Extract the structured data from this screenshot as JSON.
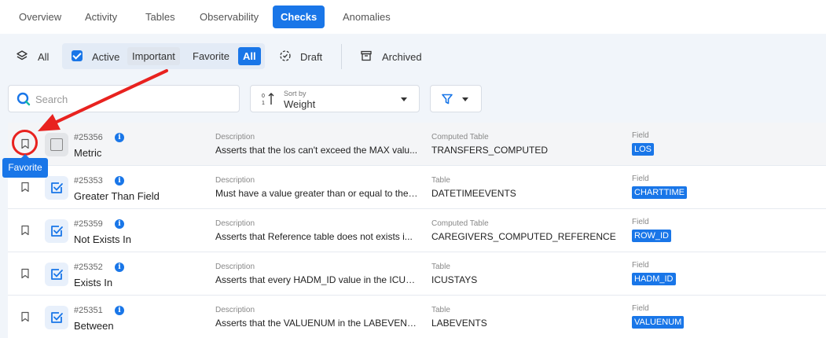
{
  "tabs": [
    {
      "label": "Overview",
      "active": false
    },
    {
      "label": "Activity",
      "active": false
    },
    {
      "label": "Tables",
      "active": false
    },
    {
      "label": "Observability",
      "active": false
    },
    {
      "label": "Checks",
      "active": true
    },
    {
      "label": "Anomalies",
      "active": false
    }
  ],
  "filters": {
    "all_label": "All",
    "active_label": "Active",
    "important_label": "Important",
    "favorite_label": "Favorite",
    "all_sub_label": "All",
    "draft_label": "Draft",
    "archived_label": "Archived"
  },
  "search": {
    "placeholder": "Search",
    "value": ""
  },
  "sort": {
    "label": "Sort by",
    "value": "Weight"
  },
  "tooltip": {
    "text": "Favorite"
  },
  "colors": {
    "accent": "#1976e8",
    "annotation": "#e8221f"
  },
  "rows": [
    {
      "id": "#25356",
      "name": "Metric",
      "desc_label": "Description",
      "desc": "Asserts that the los can't exceed the MAX valu...",
      "table_label": "Computed Table",
      "table": "TRANSFERS_COMPUTED",
      "field_label": "Field",
      "field": "LOS"
    },
    {
      "id": "#25353",
      "name": "Greater Than Field",
      "desc_label": "Description",
      "desc": "Must have a value greater than or equal to the ...",
      "table_label": "Table",
      "table": "DATETIMEEVENTS",
      "field_label": "Field",
      "field": "CHARTTIME"
    },
    {
      "id": "#25359",
      "name": "Not Exists In",
      "desc_label": "Description",
      "desc": "Asserts that Reference table does not exists i...",
      "table_label": "Computed Table",
      "table": "CAREGIVERS_COMPUTED_REFERENCE",
      "field_label": "Field",
      "field": "ROW_ID"
    },
    {
      "id": "#25352",
      "name": "Exists In",
      "desc_label": "Description",
      "desc": "Asserts that every HADM_ID value in the ICUS...",
      "table_label": "Table",
      "table": "ICUSTAYS",
      "field_label": "Field",
      "field": "HADM_ID"
    },
    {
      "id": "#25351",
      "name": "Between",
      "desc_label": "Description",
      "desc": "Asserts that the VALUENUM in the LABEVENTS...",
      "table_label": "Table",
      "table": "LABEVENTS",
      "field_label": "Field",
      "field": "VALUENUM"
    }
  ]
}
